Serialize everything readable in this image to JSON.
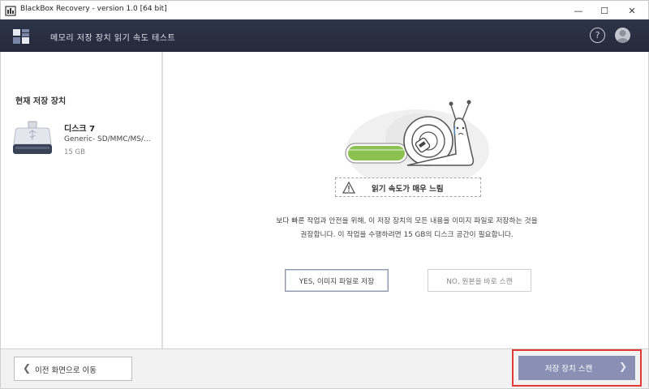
{
  "window": {
    "title": "BlackBox Recovery - version 1.0 [64 bit]",
    "minimize_glyph": "—",
    "maximize_glyph": "☐",
    "close_glyph": "✕"
  },
  "header": {
    "title": "메모리 저장 장치 읽기 속도 테스트",
    "help_glyph": "?"
  },
  "sidebar": {
    "heading": "현재 저장 장치",
    "device": {
      "name": "디스크 7",
      "model": "Generic- SD/MMC/MS/...",
      "size": "15 GB"
    }
  },
  "main": {
    "warning": "읽기 속도가 매우 느림",
    "description_line1": "보다 빠른 작업과 안전을 위해, 이 저장 장치의 모든 내용을 이미지 파일로 저장하는 것을",
    "description_line2": "권장합니다. 이 작업을 수행하려면 15 GB의 디스크 공간이 필요합니다.",
    "yes_button": "YES, 이미지 파일로 저장",
    "no_button": "NO, 원본을 바로 스캔",
    "progress_fraction": 0.2
  },
  "footer": {
    "back_button": "이전 화면으로 이동",
    "back_glyph": "❮",
    "scan_button": "저장 장치 스캔",
    "scan_glyph": "❯"
  },
  "colors": {
    "header_bg": "#232a3b",
    "accent_button": "#8a90b4",
    "highlight": "#e53935",
    "progress_green": "#8cc152"
  },
  "icons": [
    "app-icon",
    "logo-icon",
    "help-icon",
    "avatar-icon",
    "usb-drive-icon",
    "snail-icon",
    "warning-icon",
    "chevron-left-icon",
    "chevron-right-icon"
  ]
}
